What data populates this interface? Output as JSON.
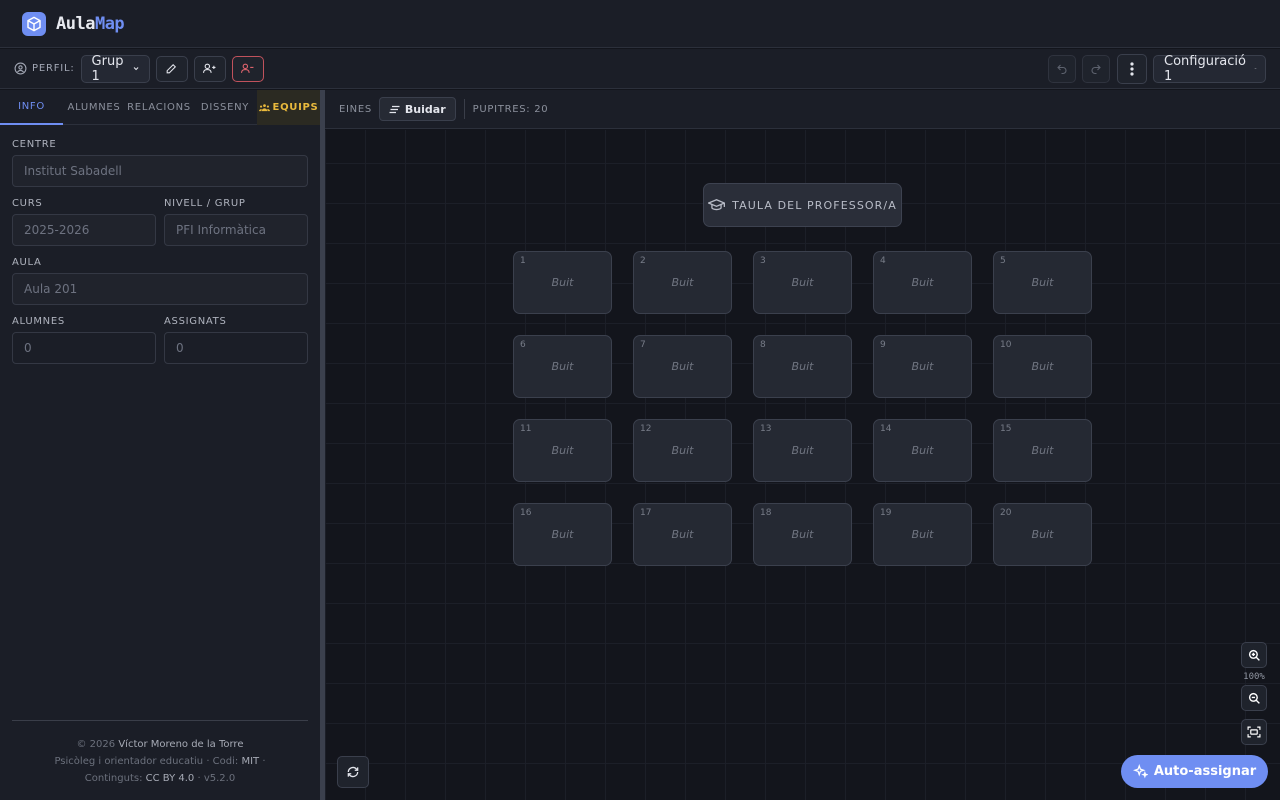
{
  "brand": {
    "part1": "Aula",
    "part2": "Map"
  },
  "toolbar": {
    "perfil_label": "PERFIL:",
    "group_value": "Grup 1",
    "config_value": "Configuració 1"
  },
  "sidebar": {
    "tabs": [
      "INFO",
      "ALUMNES",
      "RELACIONS",
      "DISSENY",
      "EQUIPS"
    ],
    "active_tab": "INFO",
    "fields": {
      "centre": {
        "label": "CENTRE",
        "placeholder": "Institut Sabadell"
      },
      "curs": {
        "label": "CURS",
        "placeholder": "2025-2026"
      },
      "nivell": {
        "label": "NIVELL / GRUP",
        "placeholder": "PFI Informàtica"
      },
      "aula": {
        "label": "AULA",
        "placeholder": "Aula 201"
      },
      "alumnes": {
        "label": "ALUMNES",
        "value": "0"
      },
      "assignats": {
        "label": "ASSIGNATS",
        "value": "0"
      }
    },
    "footer": {
      "copyright": "© 2026",
      "author": "Víctor Moreno de la Torre",
      "role": "Psicòleg i orientador educatiu",
      "code_label": "· Codi:",
      "code_license": "MIT",
      "code_suffix": "·",
      "content_label": "Continguts:",
      "content_license": "CC BY 4.0",
      "version": "· v5.2.0"
    }
  },
  "tools": {
    "label": "EINES",
    "clear_label": "Buidar",
    "desks_count": "PUPITRES: 20"
  },
  "classroom": {
    "teacher_label": "TAULA DEL PROFESSOR/A",
    "desks": [
      {
        "n": "1",
        "status": "Buit"
      },
      {
        "n": "2",
        "status": "Buit"
      },
      {
        "n": "3",
        "status": "Buit"
      },
      {
        "n": "4",
        "status": "Buit"
      },
      {
        "n": "5",
        "status": "Buit"
      },
      {
        "n": "6",
        "status": "Buit"
      },
      {
        "n": "7",
        "status": "Buit"
      },
      {
        "n": "8",
        "status": "Buit"
      },
      {
        "n": "9",
        "status": "Buit"
      },
      {
        "n": "10",
        "status": "Buit"
      },
      {
        "n": "11",
        "status": "Buit"
      },
      {
        "n": "12",
        "status": "Buit"
      },
      {
        "n": "13",
        "status": "Buit"
      },
      {
        "n": "14",
        "status": "Buit"
      },
      {
        "n": "15",
        "status": "Buit"
      },
      {
        "n": "16",
        "status": "Buit"
      },
      {
        "n": "17",
        "status": "Buit"
      },
      {
        "n": "18",
        "status": "Buit"
      },
      {
        "n": "19",
        "status": "Buit"
      },
      {
        "n": "20",
        "status": "Buit"
      }
    ]
  },
  "zoom": {
    "level": "100%"
  },
  "actions": {
    "auto_assign": "Auto-assignar"
  },
  "colors": {
    "accent": "#6f8ef2",
    "equips": "#e9b93c",
    "danger": "#c0525c",
    "background": "#13151c",
    "panel": "#1b1e27"
  }
}
